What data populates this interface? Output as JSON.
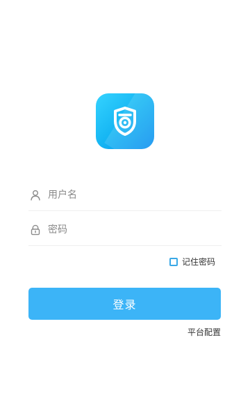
{
  "logo": {
    "icon": "shield-eye-icon",
    "colors": {
      "gradient_start": "#35d3ff",
      "gradient_mid": "#16b6f3",
      "gradient_end": "#0a8ef0",
      "glyph": "#ffffff"
    }
  },
  "login_form": {
    "username": {
      "icon": "user-icon",
      "placeholder": "用户名",
      "value": ""
    },
    "password": {
      "icon": "lock-icon",
      "placeholder": "密码",
      "value": ""
    },
    "remember": {
      "label": "记住密码",
      "checked": false,
      "accent_color": "#39a8e6"
    },
    "submit_label": "登录",
    "button_color": "#3cb4f7"
  },
  "footer": {
    "platform_config_label": "平台配置"
  }
}
